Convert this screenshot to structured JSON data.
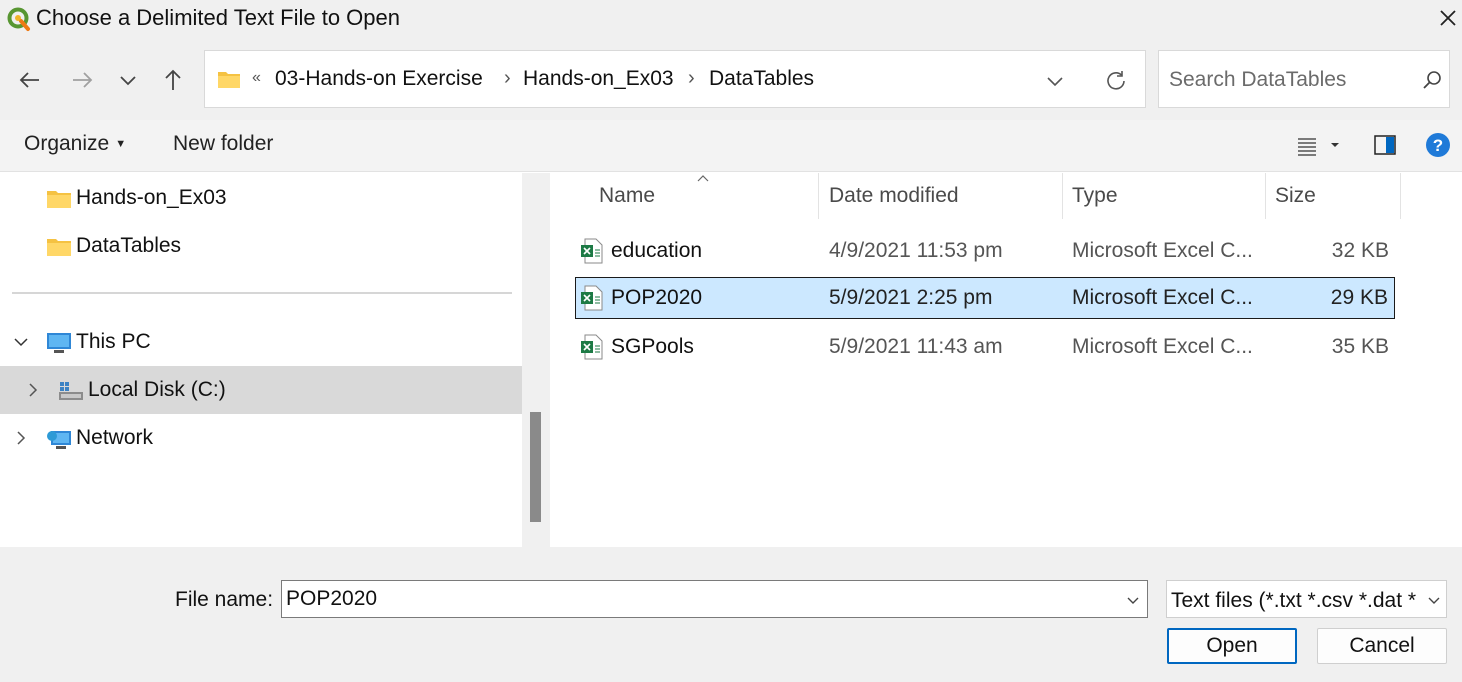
{
  "window": {
    "title": "Choose a Delimited Text File to Open"
  },
  "address": {
    "overflow_chevron": "«",
    "crumbs": [
      "03-Hands-on Exercise",
      "Hands-on_Ex03",
      "DataTables"
    ],
    "separator": "›"
  },
  "search": {
    "placeholder": "Search DataTables"
  },
  "toolbar": {
    "organize_label": "Organize",
    "new_folder_label": "New folder"
  },
  "nav_pane": {
    "items": [
      {
        "label": "Hands-on_Ex03",
        "icon": "folder-icon"
      },
      {
        "label": "DataTables",
        "icon": "folder-icon"
      },
      {
        "label": "This PC",
        "icon": "computer-icon"
      },
      {
        "label": "Local Disk (C:)",
        "icon": "disk-icon"
      },
      {
        "label": "Network",
        "icon": "network-icon"
      }
    ]
  },
  "file_list": {
    "columns": {
      "name": "Name",
      "date": "Date modified",
      "type": "Type",
      "size": "Size"
    },
    "rows": [
      {
        "name": "education",
        "date": "4/9/2021 11:53 pm",
        "type": "Microsoft Excel C...",
        "size": "32 KB"
      },
      {
        "name": "POP2020",
        "date": "5/9/2021 2:25 pm",
        "type": "Microsoft Excel C...",
        "size": "29 KB",
        "selected": true
      },
      {
        "name": "SGPools",
        "date": "5/9/2021 11:43 am",
        "type": "Microsoft Excel C...",
        "size": "35 KB"
      }
    ]
  },
  "bottom": {
    "file_name_label": "File name:",
    "file_name_value": "POP2020",
    "file_type_value": "Text files (*.txt *.csv *.dat *",
    "open_label": "Open",
    "cancel_label": "Cancel"
  },
  "colors": {
    "accent": "#0067c0",
    "selection": "#cce8ff",
    "qgis_green": "#589632",
    "excel_green": "#1d7a45"
  }
}
